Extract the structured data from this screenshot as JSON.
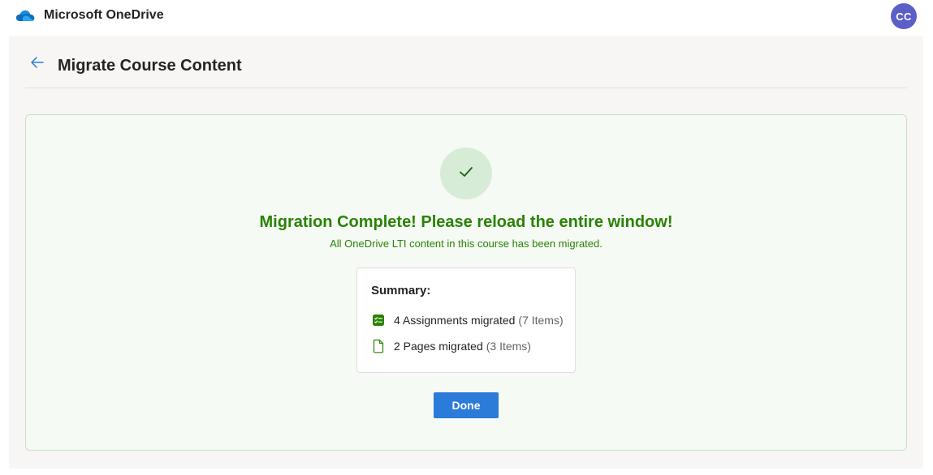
{
  "app": {
    "title": "Microsoft OneDrive",
    "user_initials": "CC",
    "logo_icon": "onedrive-cloud-icon"
  },
  "page": {
    "title": "Migrate Course Content",
    "back_icon": "arrow-left-icon"
  },
  "result": {
    "status_icon": "checkmark-icon",
    "headline": "Migration Complete! Please reload the entire window!",
    "subtext": "All OneDrive LTI content in this course has been migrated.",
    "color": "#2a8205"
  },
  "summary": {
    "title": "Summary:",
    "items": [
      {
        "icon": "assignment-checklist-icon",
        "label": "4 Assignments migrated",
        "count": "(7 Items)"
      },
      {
        "icon": "page-document-icon",
        "label": "2 Pages migrated",
        "count": "(3 Items)"
      }
    ]
  },
  "actions": {
    "done_label": "Done"
  },
  "colors": {
    "accent": "#2b7bd9",
    "avatar": "#5b5fc7",
    "success": "#2a8205"
  }
}
